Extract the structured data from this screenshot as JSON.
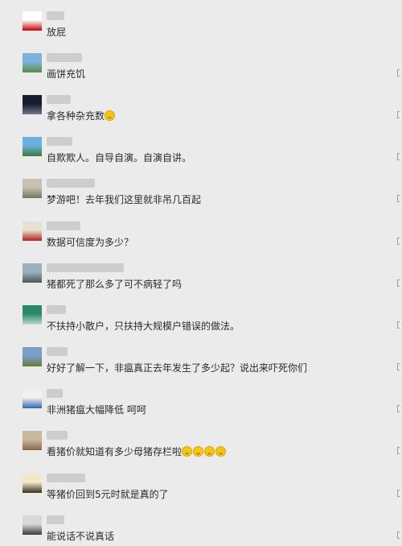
{
  "comments": [
    {
      "text": "放屁",
      "emoji_count": 0,
      "avatar_colors": [
        "#ffffff",
        "#c40000"
      ]
    },
    {
      "text": "画饼充饥",
      "emoji_count": 0,
      "avatar_colors": [
        "#7bb4d8",
        "#5a8a4a"
      ]
    },
    {
      "text": "拿各种杂充数",
      "emoji_count": 1,
      "avatar_colors": [
        "#1a1a2a",
        "#6a7a8a"
      ]
    },
    {
      "text": "自欺欺人。自导自演。自演自讲。",
      "emoji_count": 0,
      "avatar_colors": [
        "#6ab0e0",
        "#3e7a3a"
      ]
    },
    {
      "text": "梦游吧！去年我们这里就非吊几百起",
      "emoji_count": 0,
      "avatar_colors": [
        "#c8c0b0",
        "#6a7a5a"
      ]
    },
    {
      "text": "数据可信度为多少？",
      "emoji_count": 0,
      "avatar_colors": [
        "#e8e0d0",
        "#b02020"
      ]
    },
    {
      "text": "猪都死了那么多了可不病轻了吗",
      "emoji_count": 0,
      "avatar_colors": [
        "#9ab0c0",
        "#4a5a4a"
      ]
    },
    {
      "text": "不扶持小散户，只扶持大规模户错误的做法。",
      "emoji_count": 0,
      "avatar_colors": [
        "#2a8a6a",
        "#c0d8c8"
      ]
    },
    {
      "text": "好好了解一下，非瘟真正去年发生了多少起？说出来吓死你们",
      "emoji_count": 0,
      "avatar_colors": [
        "#7aa0c8",
        "#6a7a3a"
      ]
    },
    {
      "text": "非洲猪瘟大幅降低    呵呵",
      "emoji_count": 0,
      "avatar_colors": [
        "#f0f0f0",
        "#2a6ab0"
      ]
    },
    {
      "text": "看猪价就知道有多少母猪存栏啦",
      "emoji_count": 4,
      "avatar_colors": [
        "#c8b8a0",
        "#8a6a4a"
      ]
    },
    {
      "text": "等猪价回到5元时就是真的了",
      "emoji_count": 0,
      "avatar_colors": [
        "#f0e8c8",
        "#3a3020"
      ]
    },
    {
      "text": "能说话不说真话",
      "emoji_count": 0,
      "avatar_colors": [
        "#d8d8d8",
        "#3a3a3a"
      ]
    }
  ]
}
